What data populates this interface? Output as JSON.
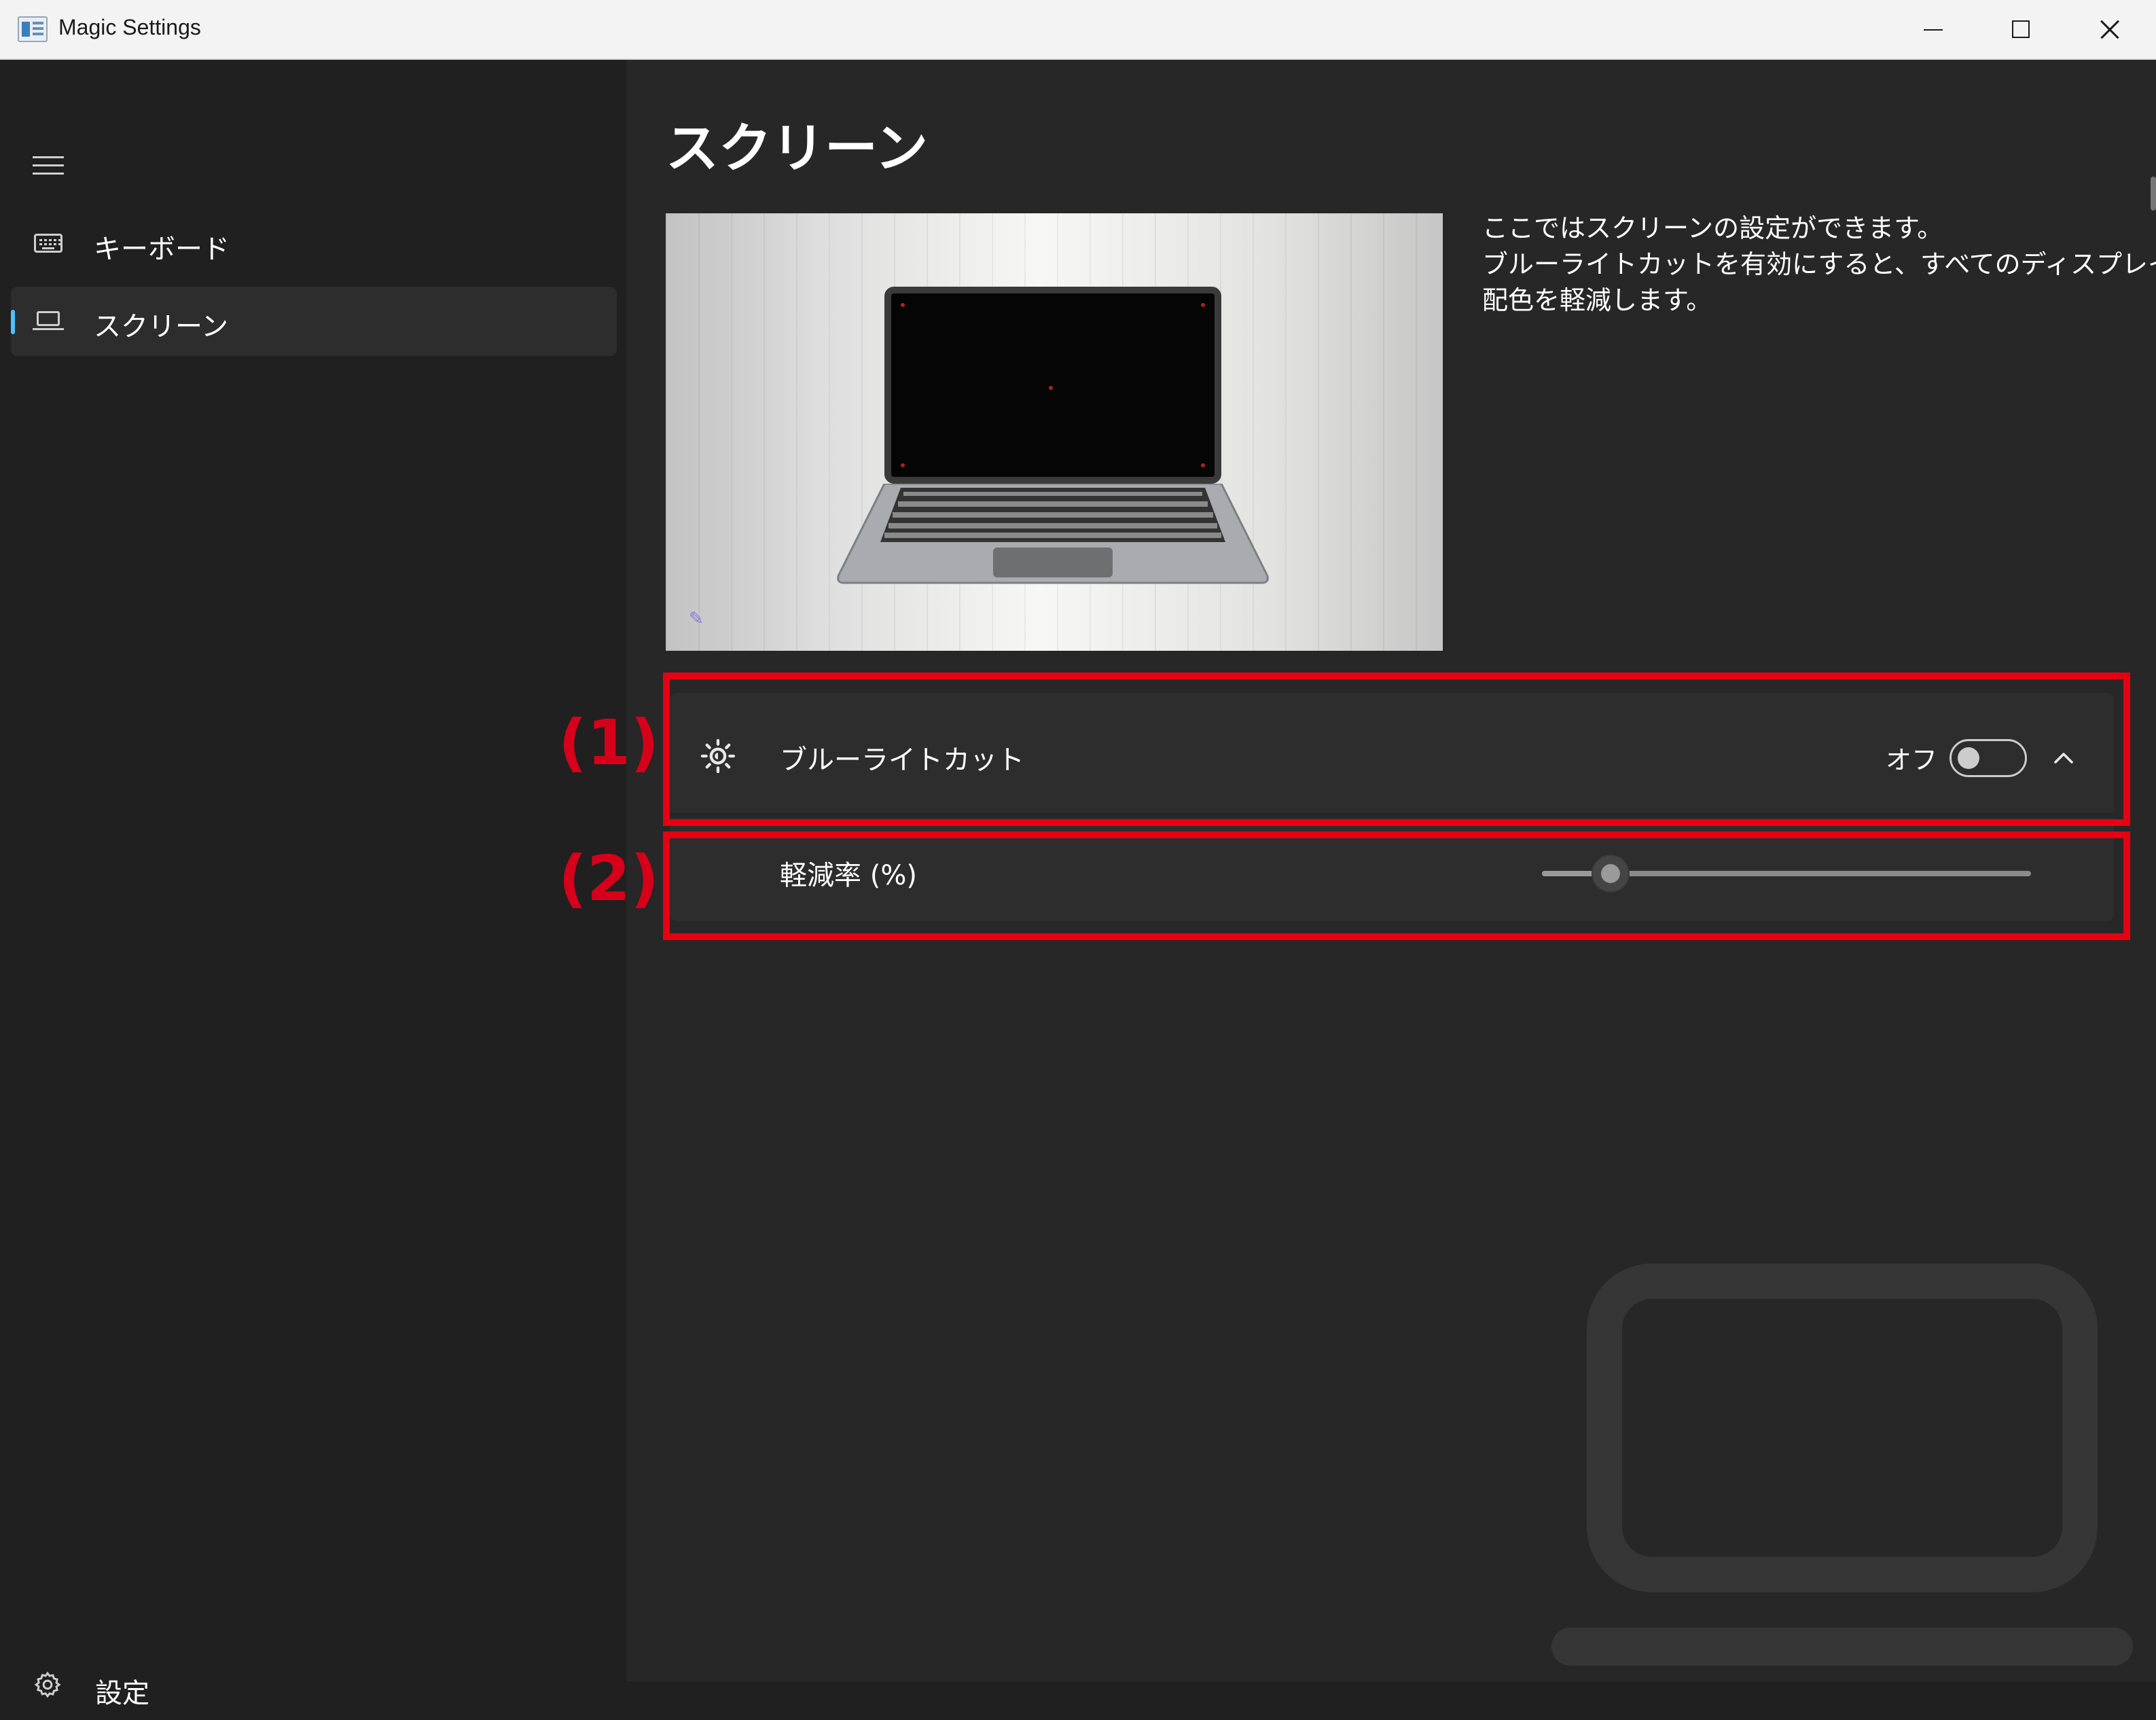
{
  "window": {
    "title": "Magic Settings"
  },
  "sidebar": {
    "items": [
      {
        "label": "キーボード",
        "icon": "keyboard-icon",
        "selected": false
      },
      {
        "label": "スクリーン",
        "icon": "laptop-icon",
        "selected": true
      }
    ],
    "footer": {
      "label": "設定",
      "icon": "gear-icon"
    }
  },
  "main": {
    "title": "スクリーン",
    "description": [
      "ここではスクリーンの設定ができます。",
      "ブルーライトカットを有効にすると、すべてのディスプレイの青色",
      "配色を軽減します。"
    ],
    "blue_light": {
      "label": "ブルーライトカット",
      "state_text": "オフ",
      "enabled": false,
      "expanded": true,
      "icon": "sun-icon"
    },
    "reduction": {
      "label": "軽減率 (%)",
      "value_fraction": 0.14
    }
  },
  "annotations": [
    "(1)",
    "(2)"
  ],
  "colors": {
    "accent": "#4cc2ff",
    "annotation_red": "#e60012",
    "background": "#202020",
    "card": "#2d2d2d"
  }
}
